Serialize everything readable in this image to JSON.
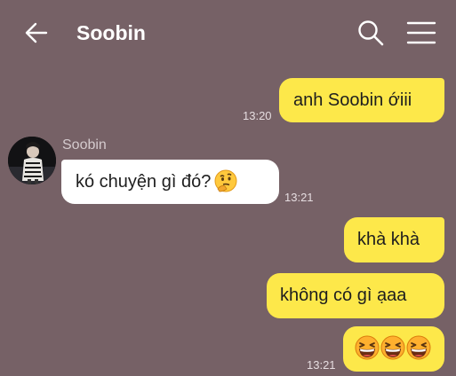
{
  "header": {
    "title": "Soobin",
    "back_icon": "arrow-left-icon",
    "search_icon": "search-icon",
    "menu_icon": "hamburger-menu-icon"
  },
  "messages": [
    {
      "side": "outgoing",
      "text": "anh Soobin ớiii",
      "time": "13:20"
    },
    {
      "side": "incoming",
      "sender": "Soobin",
      "text": "kó chuyện gì đó?",
      "emoji": "thinking-face-icon",
      "time": "13:21"
    },
    {
      "side": "outgoing",
      "text": "khà khà"
    },
    {
      "side": "outgoing",
      "text": "không có gì ạaa"
    },
    {
      "side": "outgoing",
      "emoji": "grinning-squinting-face-icon x3",
      "time": "13:21"
    }
  ],
  "colors": {
    "background": "#766166",
    "outgoing_bubble": "#fde84a",
    "incoming_bubble": "#ffffff"
  }
}
